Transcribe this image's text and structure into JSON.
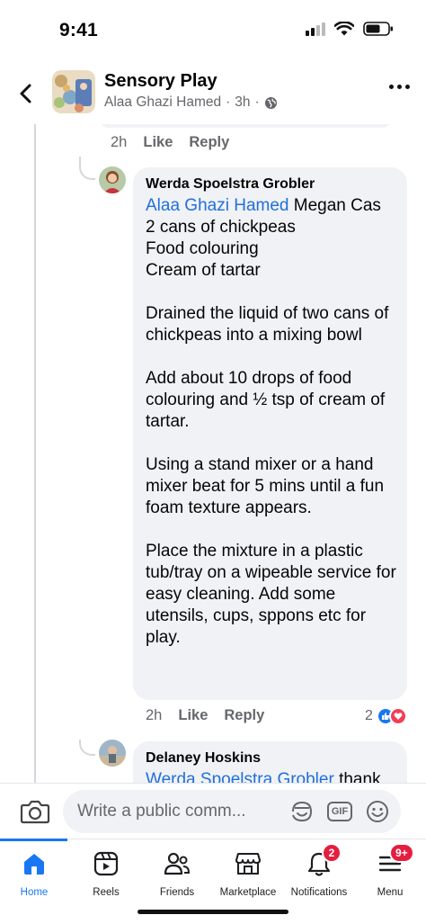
{
  "status_bar": {
    "time": "9:41"
  },
  "header": {
    "title": "Sensory Play",
    "subtitle_author": "Alaa Ghazi Hamed",
    "subtitle_separator": "·",
    "subtitle_time": "3h",
    "subtitle_separator2": "·"
  },
  "thread": {
    "parent_actions": {
      "time": "2h",
      "like": "Like",
      "reply": "Reply"
    },
    "comment1": {
      "author": "Werda Spoelstra Grobler",
      "mention1": "Alaa Ghazi Hamed",
      "mention2_text": " Megan Cas",
      "body": "\n2 cans of chickpeas\nFood colouring\nCream of tartar\n\nDrained the liquid of two cans of chickpeas into a mixing bowl\n\nAdd about 10 drops of food colouring and ½ tsp of cream of tartar.\n\nUsing a stand mixer or a hand mixer beat for 5 mins until a fun foam texture appears.\n\nPlace the mixture in a plastic tub/tray on a wipeable service for easy cleaning. Add some utensils, cups, sppons etc for play.",
      "time": "2h",
      "like": "Like",
      "reply": "Reply",
      "reaction_count": "2"
    },
    "comment2": {
      "author": "Delaney Hoskins",
      "mention": "Werda Spoelstra Grobler",
      "body_tail": " thank"
    }
  },
  "composer": {
    "placeholder": "Write a public comm...",
    "gif_label": "GIF"
  },
  "bottom_nav": {
    "items": [
      {
        "label": "Home",
        "icon": "home-icon"
      },
      {
        "label": "Reels",
        "icon": "reels-icon"
      },
      {
        "label": "Friends",
        "icon": "friends-icon"
      },
      {
        "label": "Marketplace",
        "icon": "marketplace-icon"
      },
      {
        "label": "Notifications",
        "icon": "bell-icon",
        "badge": "2"
      },
      {
        "label": "Menu",
        "icon": "menu-icon",
        "badge": "9+"
      }
    ]
  },
  "colors": {
    "accent": "#1877f2",
    "mention": "#216fdb",
    "badge": "#e41e3f",
    "bubble": "#f0f2f5",
    "secondary_text": "#65676b"
  }
}
